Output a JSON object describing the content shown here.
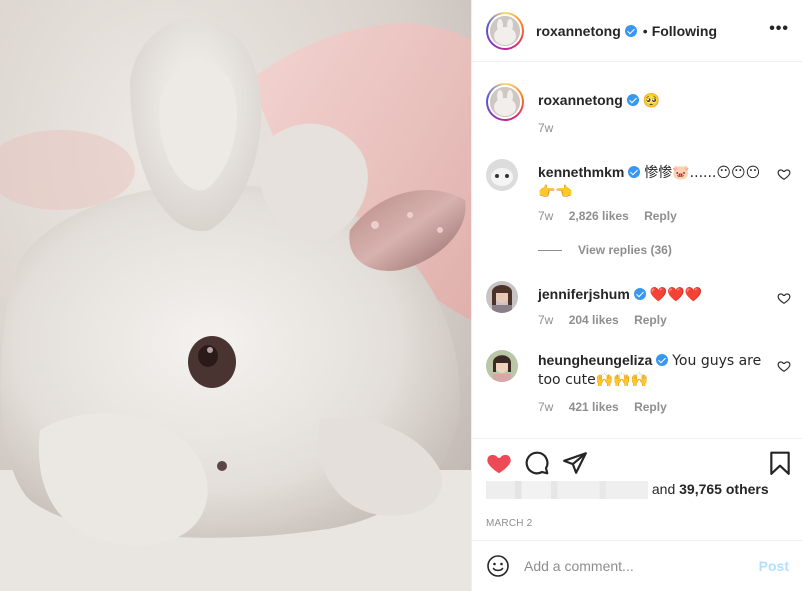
{
  "post": {
    "username": "roxannetong",
    "follow_status": "Following",
    "more_icon": "more-horizontal-icon",
    "caption_emoji": "🥺",
    "caption_age": "7w"
  },
  "comments": [
    {
      "username": "kennethmkm",
      "text": "惨惨🐷......😶😶😶👉👈",
      "age": "7w",
      "likes": "2,826 likes",
      "reply": "Reply",
      "view_replies": "View replies (36)"
    },
    {
      "username": "jenniferjshum",
      "text": "❤️❤️❤️",
      "age": "7w",
      "likes": "204 likes",
      "reply": "Reply"
    },
    {
      "username": "heungheungeliza",
      "text": "You guys are too cute🙌🙌🙌",
      "age": "7w",
      "likes": "421 likes",
      "reply": "Reply"
    }
  ],
  "actions": {
    "like_icon": "heart-filled-icon",
    "comment_icon": "comment-icon",
    "share_icon": "share-icon",
    "save_icon": "bookmark-icon"
  },
  "likes_summary": {
    "and_text": "and",
    "others_text": "39,765 others"
  },
  "date": "MARCH 2",
  "add_comment": {
    "placeholder": "Add a comment...",
    "post_label": "Post",
    "emoji_icon": "smiley-icon"
  },
  "colors": {
    "accent_blue": "#3897f0",
    "heart_red": "#ed4956",
    "post_disabled": "#b2dffc",
    "muted_text": "#8e8e8e"
  }
}
